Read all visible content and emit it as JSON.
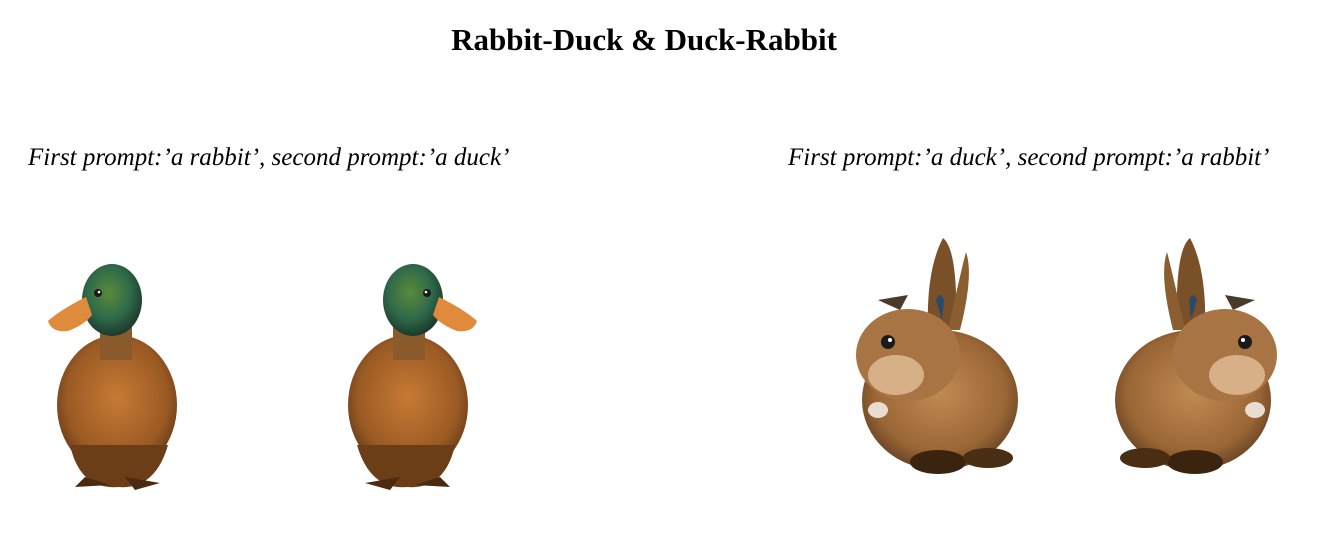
{
  "page": {
    "title": "Rabbit-Duck & Duck-Rabbit"
  },
  "panels": [
    {
      "caption": "First prompt:’a rabbit’, second prompt:’a duck’",
      "images": [
        {
          "depicts": "duck",
          "facing": "left"
        },
        {
          "depicts": "duck",
          "facing": "right"
        }
      ]
    },
    {
      "caption": "First prompt:’a duck’, second prompt:’a rabbit’",
      "images": [
        {
          "depicts": "rabbit",
          "facing": "left"
        },
        {
          "depicts": "rabbit",
          "facing": "right"
        }
      ]
    }
  ],
  "colors": {
    "background": "#ffffff",
    "duck_body": "#b0662a",
    "duck_head": "#2f6a4a",
    "duck_bill": "#e08a3c",
    "rabbit_fur": "#a8703f",
    "rabbit_dark": "#5a3a1e"
  }
}
